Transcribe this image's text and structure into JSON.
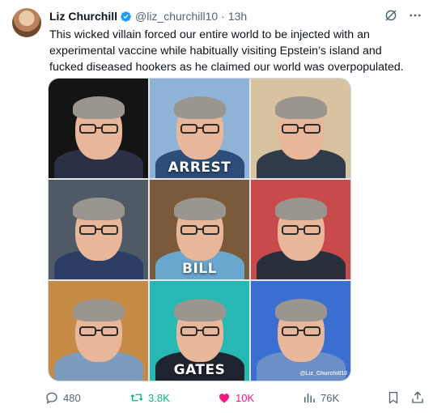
{
  "tweet": {
    "author_name": "Liz Churchill",
    "handle": "@liz_churchill10",
    "separator": "·",
    "time": "13h",
    "text": "This wicked villain forced our entire world to be injected with an experimental vaccine while habitually visiting Epstein’s island and fucked diseased hookers as he claimed our world was overpopulated."
  },
  "media": {
    "captions": {
      "top": "ARREST",
      "middle": "BILL",
      "bottom": "GATES"
    },
    "watermark": "@Liz_Churchill10",
    "cells": [
      {
        "bg": "#141414",
        "shirt": "#2a3146",
        "caption": ""
      },
      {
        "bg": "#8fb3d6",
        "shirt": "#2d4d7a",
        "caption": "ARREST"
      },
      {
        "bg": "#d7c3a0",
        "shirt": "#2f3a4a",
        "caption": ""
      },
      {
        "bg": "#4f5a66",
        "shirt": "#2c3e64",
        "caption": ""
      },
      {
        "bg": "#7a5a3a",
        "shirt": "#6aa7cf",
        "caption": "BILL"
      },
      {
        "bg": "#c94a4a",
        "shirt": "#2a2f3c",
        "caption": ""
      },
      {
        "bg": "#c58b45",
        "shirt": "#7d9bbc",
        "caption": ""
      },
      {
        "bg": "#27b8b3",
        "shirt": "#1f2530",
        "caption": "GATES"
      },
      {
        "bg": "#3a6fd1",
        "shirt": "#6d8fc7",
        "caption": ""
      }
    ]
  },
  "actions": {
    "replies": "480",
    "retweets": "3.8K",
    "likes": "10K",
    "views": "76K"
  },
  "colors": {
    "accent_blue": "#1d9bf0",
    "retweet_green": "#00ba7c",
    "like_pink": "#f91880",
    "muted": "#536471"
  }
}
